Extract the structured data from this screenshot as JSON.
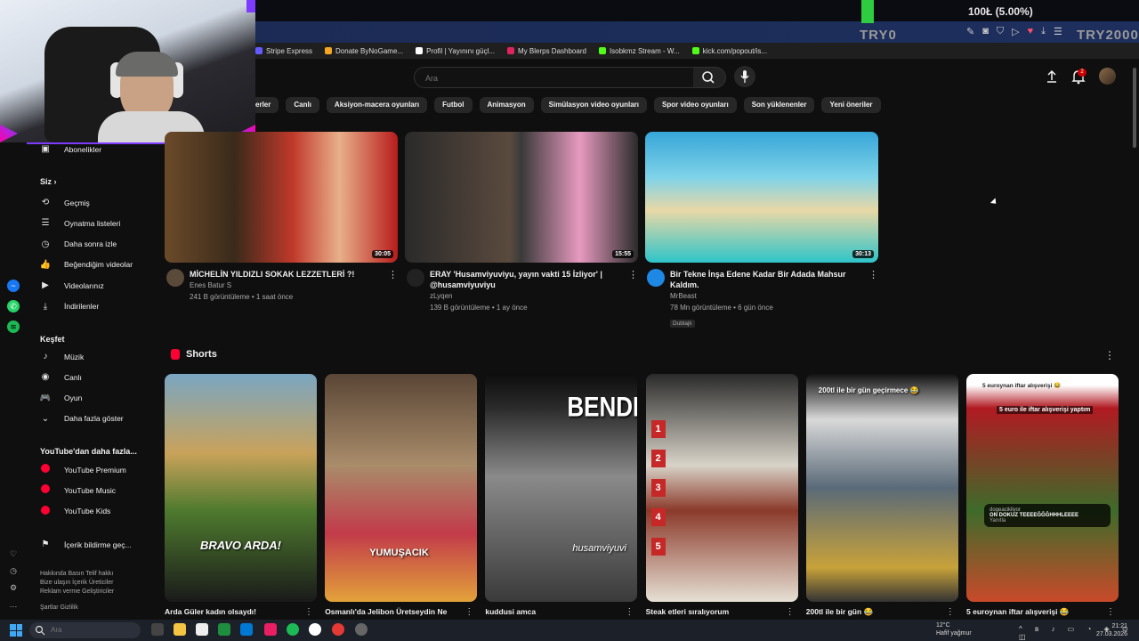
{
  "stream_overlay": {
    "stats": "100Ł (5.00%)",
    "tag_left": "TRY0",
    "tag_right": "TRY2000"
  },
  "bookmarks": [
    {
      "label": "Stripe Express",
      "color": "#635bff"
    },
    {
      "label": "Donate ByNoGame...",
      "color": "#f5a623"
    },
    {
      "label": "Profil | Yayınını güçl...",
      "color": "#ffffff"
    },
    {
      "label": "My Blerps Dashboard",
      "color": "#e0245e"
    },
    {
      "label": "Isobkmz Stream - W...",
      "color": "#53fc18"
    },
    {
      "label": "kick.com/popout/is...",
      "color": "#53fc18"
    }
  ],
  "header": {
    "search_placeholder": "Ara",
    "notification_count": "2"
  },
  "chips": [
    "erler",
    "Canlı",
    "Aksiyon-macera oyunları",
    "Futbol",
    "Animasyon",
    "Simülasyon video oyunları",
    "Spor video oyunları",
    "Son yüklenenler",
    "Yeni öneriler"
  ],
  "sidebar": {
    "subscriptions_label": "Abonelikler",
    "you_label": "Siz",
    "you_items": [
      {
        "label": "Geçmiş",
        "icon": "history-icon",
        "glyph": "⟲"
      },
      {
        "label": "Oynatma listeleri",
        "icon": "playlist-icon",
        "glyph": "☰"
      },
      {
        "label": "Daha sonra izle",
        "icon": "clock-icon",
        "glyph": "◷"
      },
      {
        "label": "Beğendiğim videolar",
        "icon": "thumbs-up-icon",
        "glyph": "👍"
      },
      {
        "label": "Videolarınız",
        "icon": "your-videos-icon",
        "glyph": "▶"
      },
      {
        "label": "İndirilenler",
        "icon": "download-icon",
        "glyph": "⤓"
      }
    ],
    "explore_label": "Keşfet",
    "explore_items": [
      {
        "label": "Müzik",
        "icon": "music-icon",
        "glyph": "♪"
      },
      {
        "label": "Canlı",
        "icon": "live-icon",
        "glyph": "◉"
      },
      {
        "label": "Oyun",
        "icon": "gaming-icon",
        "glyph": "🎮"
      },
      {
        "label": "Daha fazla göster",
        "icon": "chevron-down-icon",
        "glyph": "⌄"
      }
    ],
    "more_label": "YouTube'dan daha fazla...",
    "more_items": [
      {
        "label": "YouTube Premium",
        "icon": "youtube-premium-icon"
      },
      {
        "label": "YouTube Music",
        "icon": "youtube-music-icon"
      },
      {
        "label": "YouTube Kids",
        "icon": "youtube-kids-icon"
      }
    ],
    "report_label": "İçerik bildirme geç...",
    "footer_lines": [
      "Hakkında  Basın  Telif hakkı",
      "Bize ulaşın  İçerik Üreticiler",
      "Reklam verme  Geliştiriciler"
    ],
    "footer_bottom": "Şartlar  Gizlilik"
  },
  "videos": [
    {
      "title": "MİCHELİN YILDIZLI SOKAK LEZZETLERİ ?!",
      "channel": "Enes Batur S",
      "stats": "241 B görüntüleme • 1 saat önce",
      "duration": "30:05",
      "avatar_color": "#5a4a3a",
      "badge": ""
    },
    {
      "title": "ERAY 'Husamviyuviyu, yayın vakti 15 İzliyor' | @husamviyuviyu",
      "channel": "zLyqen",
      "stats": "139 B görüntüleme • 1 ay önce",
      "duration": "15:55",
      "avatar_color": "#222222",
      "badge": ""
    },
    {
      "title": "Bir Tekne İnşa Edene Kadar Bir Adada Mahsur Kaldım.",
      "channel": "MrBeast",
      "stats": "78 Mn görüntüleme • 6 gün önce",
      "duration": "30:13",
      "avatar_color": "#1e88e5",
      "badge": "Dublajlı"
    }
  ],
  "shorts": {
    "label": "Shorts",
    "items": [
      {
        "title": "Arda Güler kadın olsaydı!",
        "overlay": "BRAVO ARDA!"
      },
      {
        "title": "Osmanlı'da Jelibon Üretseydin Ne",
        "overlay": "YUMUŞACIK"
      },
      {
        "title": "kuddusi amca",
        "overlay": "BENDE GÖT"
      },
      {
        "title": "Steak etleri sıralıyorum",
        "overlay": ""
      },
      {
        "title": "200tl ile bir gün 😂",
        "overlay": "200tl ile bir gün geçirmece 😂"
      },
      {
        "title": "5 euroynan iftar alışverişi 😂",
        "overlay": "5 euroynan iftar alışverişi 😂"
      }
    ],
    "extra_caption": "5 euro ile iftar alışverişi yaptım",
    "comment_user": "dogeacikliyor",
    "comment_text": "ON DOKUZ TEEEEĞĞĞHHHLEEEE",
    "comment_reply": "Yanıtla",
    "watermark": "husamviyuvi"
  },
  "taskbar": {
    "search_placeholder": "Ara",
    "weather_temp": "12°C",
    "weather_desc": "Hafif yağmur",
    "time": "21:21",
    "date": "27.03.2026"
  },
  "colors": {
    "accent": "#ff0033",
    "background": "#0f0f0f"
  }
}
